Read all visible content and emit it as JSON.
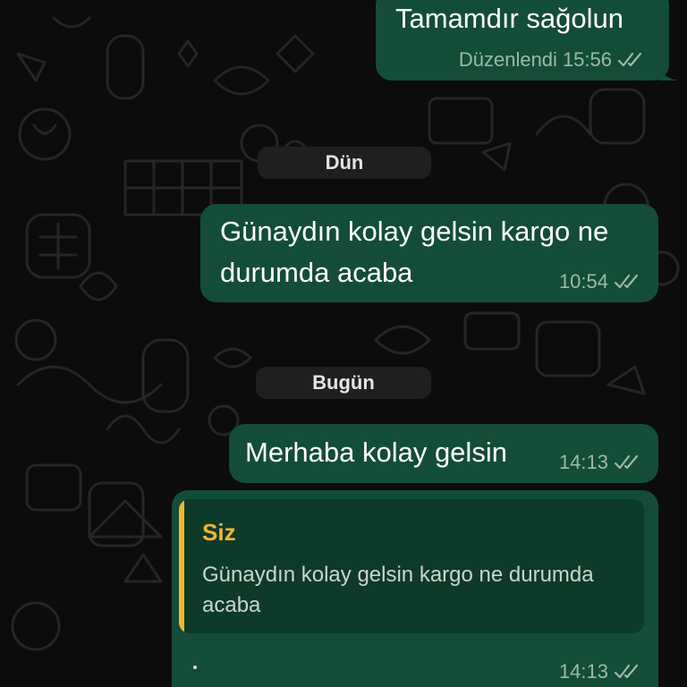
{
  "colors": {
    "background": "#0c0c0c",
    "outgoing_bubble": "#134d37",
    "quote_background": "#0e3a29",
    "quote_accent": "#f2b632",
    "date_chip": "#1f1f21",
    "meta_text": "#9fb8ac"
  },
  "messages": [
    {
      "text": "Tamamdır sağolun",
      "edited_label": "Düzenlendi",
      "time": "15:56",
      "status_icon": "double-check-icon"
    },
    {
      "text": "Günaydın kolay gelsin kargo ne\ndurumda acaba",
      "time": "10:54",
      "status_icon": "double-check-icon"
    },
    {
      "text": "Merhaba kolay gelsin",
      "time": "14:13",
      "status_icon": "double-check-icon"
    },
    {
      "text": ".",
      "time": "14:13",
      "status_icon": "double-check-icon",
      "reply": {
        "author": "Siz",
        "text": "Günaydın kolay gelsin kargo ne durumda acaba"
      }
    }
  ],
  "date_separators": [
    "Dün",
    "Bugün"
  ]
}
